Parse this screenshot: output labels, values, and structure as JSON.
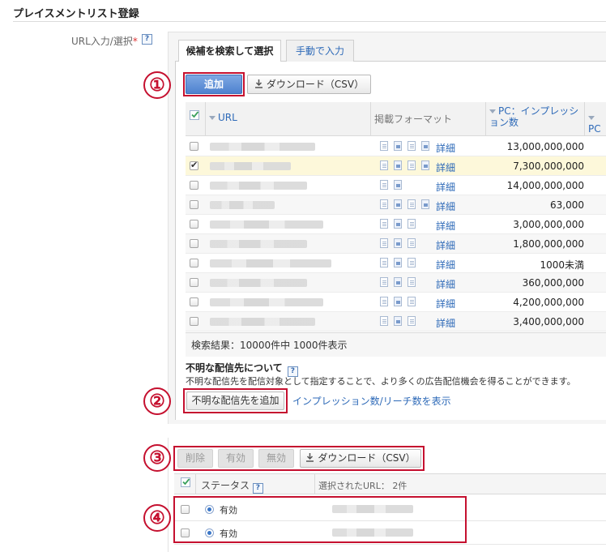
{
  "page_title": "プレイスメントリスト登録",
  "field_label": "URL入力/選択",
  "required_mark": "*",
  "help_mark": "?",
  "tabs": [
    {
      "label": "候補を検索して選択",
      "active": true
    },
    {
      "label": "手動で入力",
      "active": false
    }
  ],
  "toolbar": {
    "add_label": "追加",
    "download_label": "ダウンロード（CSV）"
  },
  "grid": {
    "columns": {
      "url": "URL",
      "format": "掲載フォーマット",
      "impressions_line1": "PC：インプレッシ",
      "impressions_line2": "ョン数",
      "pc_next": "PC"
    },
    "detail_label": "詳細",
    "rows": [
      {
        "checked": false,
        "impressions": "13,000,000,000"
      },
      {
        "checked": true,
        "impressions": "7,300,000,000"
      },
      {
        "checked": false,
        "impressions": "14,000,000,000"
      },
      {
        "checked": false,
        "impressions": "63,000"
      },
      {
        "checked": false,
        "impressions": "3,000,000,000"
      },
      {
        "checked": false,
        "impressions": "1,800,000,000"
      },
      {
        "checked": false,
        "impressions": "1000未満"
      },
      {
        "checked": false,
        "impressions": "360,000,000"
      },
      {
        "checked": false,
        "impressions": "4,200,000,000"
      },
      {
        "checked": false,
        "impressions": "3,400,000,000"
      }
    ],
    "result_summary": "検索結果：10000件中 1000件表示"
  },
  "unknown": {
    "title": "不明な配信先について",
    "description": "不明な配信先を配信対象として指定することで、より多くの広告配信機会を得ることができます。",
    "add_button": "不明な配信先を追加",
    "show_link": "インプレッション数/リーチ数を表示"
  },
  "selected_toolbar": {
    "delete_label": "削除",
    "enable_label": "有効",
    "disable_label": "無効",
    "download_label": "ダウンロード（CSV）"
  },
  "selected_table": {
    "status_header": "ステータス",
    "selected_url_header": "選択されたURL： 2件",
    "rows": [
      {
        "status": "有効"
      },
      {
        "status": "有効"
      }
    ]
  },
  "annotations": [
    "①",
    "②",
    "③",
    "④"
  ],
  "colors": {
    "annotation_red": "#c5102f",
    "link_blue": "#2e6ab8",
    "primary_blue": "#4e82cf",
    "selected_row": "#fdf8da"
  }
}
